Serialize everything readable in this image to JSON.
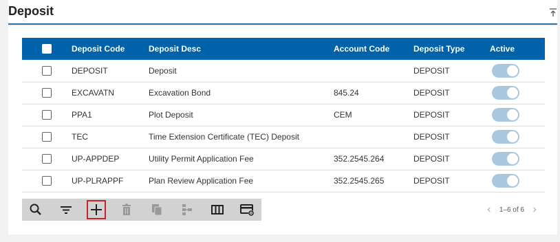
{
  "panel": {
    "title": "Deposit"
  },
  "table": {
    "headers": {
      "code": "Deposit Code",
      "desc": "Deposit Desc",
      "account": "Account Code",
      "type": "Deposit Type",
      "active": "Active"
    },
    "rows": [
      {
        "code": "DEPOSIT",
        "desc": "Deposit",
        "account": "",
        "type": "DEPOSIT",
        "active": true
      },
      {
        "code": "EXCAVATN",
        "desc": "Excavation Bond",
        "account": "845.24",
        "type": "DEPOSIT",
        "active": true
      },
      {
        "code": "PPA1",
        "desc": "Plot Deposit",
        "account": "CEM",
        "type": "DEPOSIT",
        "active": true
      },
      {
        "code": "TEC",
        "desc": "Time Extension Certificate (TEC) Deposit",
        "account": "",
        "type": "DEPOSIT",
        "active": true
      },
      {
        "code": "UP-APPDEP",
        "desc": "Utility Permit Application Fee",
        "account": "352.2545.264",
        "type": "DEPOSIT",
        "active": true
      },
      {
        "code": "UP-PLRAPPF",
        "desc": "Plan Review Application Fee",
        "account": "352.2545.265",
        "type": "DEPOSIT",
        "active": true
      }
    ]
  },
  "toolbar": {
    "buttons": [
      "search-icon",
      "filter-icon",
      "add-icon",
      "delete-icon",
      "copy-icon",
      "hierarchy-icon",
      "columns-icon",
      "card-settings-icon"
    ]
  },
  "pager": {
    "range": "1–6 of 6",
    "prev": "‹",
    "next": "›"
  },
  "colors": {
    "header_bg": "#0062a8",
    "toggle_on": "#a9c8df",
    "add_highlight": "#c0262c"
  }
}
